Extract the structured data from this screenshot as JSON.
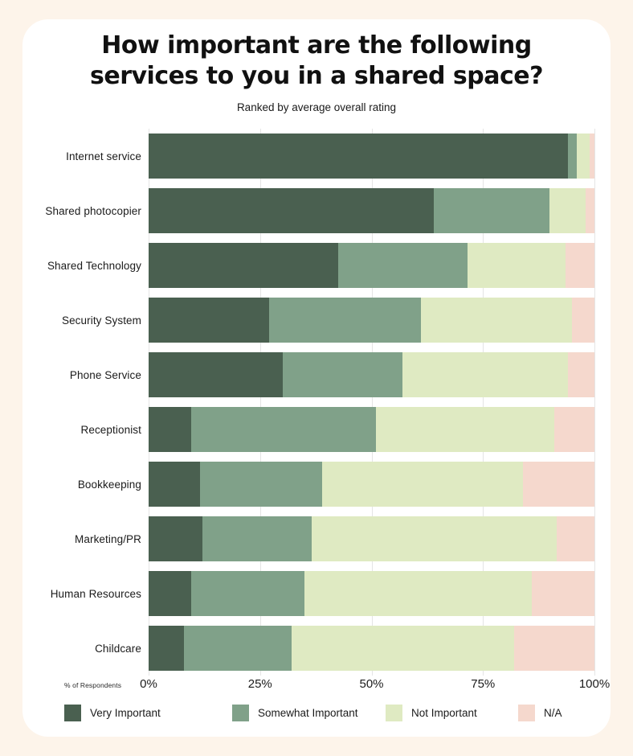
{
  "header": {
    "title": "How important are the following services to you in a shared space?",
    "subtitle": "Ranked by average overall rating"
  },
  "axis": {
    "caption": "% of Respondents",
    "ticks": [
      "0%",
      "25%",
      "50%",
      "75%",
      "100%"
    ]
  },
  "legend": [
    {
      "label": "Very Important",
      "color": "#4a6050",
      "icon": "legend-swatch-very-important"
    },
    {
      "label": "Somewhat Important",
      "color": "#80a189",
      "icon": "legend-swatch-somewhat-important"
    },
    {
      "label": "Not Important",
      "color": "#dfeac2",
      "icon": "legend-swatch-not-important"
    },
    {
      "label": "N/A",
      "color": "#f5d8cd",
      "icon": "legend-swatch-na"
    }
  ],
  "chart_data": {
    "type": "bar",
    "subtype": "horizontal-stacked-100",
    "title": "How important are the following services to you in a shared space?",
    "subtitle": "Ranked by average overall rating",
    "xlabel": "% of Respondents",
    "ylabel": "",
    "xlim": [
      0,
      100
    ],
    "xticks": [
      0,
      25,
      50,
      75,
      100
    ],
    "grid": true,
    "legend_position": "bottom",
    "categories": [
      "Internet service",
      "Shared photocopier",
      "Shared Technology",
      "Security System",
      "Phone Service",
      "Receptionist",
      "Bookkeeping",
      "Marketing/PR",
      "Human Resources",
      "Childcare"
    ],
    "series": [
      {
        "name": "Very Important",
        "color": "#4a6050",
        "values": [
          94,
          64,
          42.5,
          27,
          30,
          9.5,
          11.5,
          12,
          9.5,
          8
        ]
      },
      {
        "name": "Somewhat Important",
        "color": "#80a189",
        "values": [
          2,
          26,
          29,
          34,
          27,
          41.5,
          27.5,
          24.5,
          25.5,
          24
        ]
      },
      {
        "name": "Not Important",
        "color": "#dfeac2",
        "values": [
          3,
          8,
          22,
          34,
          37,
          40,
          45,
          55,
          51,
          50
        ]
      },
      {
        "name": "N/A",
        "color": "#f5d8cd",
        "values": [
          1,
          2,
          6.5,
          5,
          6,
          9,
          16,
          8.5,
          14,
          18
        ]
      }
    ]
  }
}
